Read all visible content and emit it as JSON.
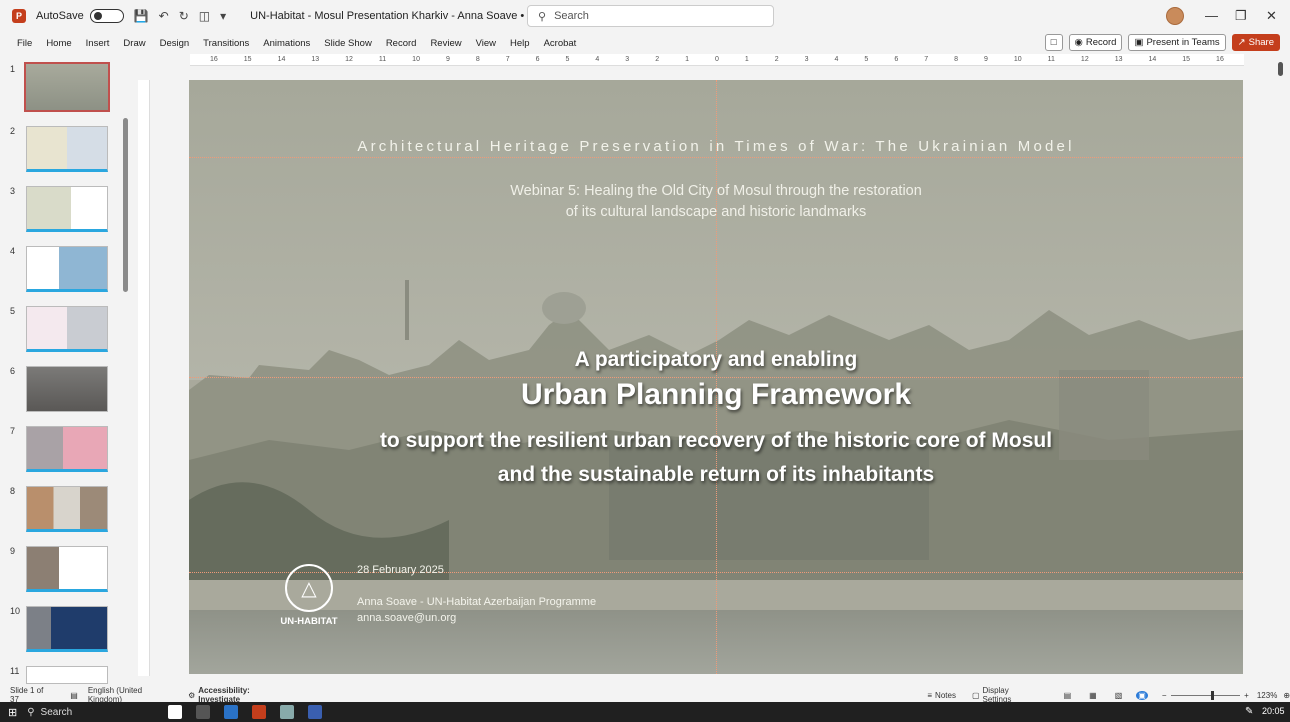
{
  "titlebar": {
    "autosave_label": "AutoSave",
    "doc_title": "UN-Habitat - Mosul Presentation Kharkiv - Anna Soave • Saved to this PC",
    "search_placeholder": "Search"
  },
  "menu": {
    "tabs": [
      "File",
      "Home",
      "Insert",
      "Draw",
      "Design",
      "Transitions",
      "Animations",
      "Slide Show",
      "Record",
      "Review",
      "View",
      "Help",
      "Acrobat"
    ],
    "record_label": "Record",
    "present_label": "Present in Teams",
    "share_label": "Share"
  },
  "thumbnails": [
    "1",
    "2",
    "3",
    "4",
    "5",
    "6",
    "7",
    "8",
    "9",
    "10",
    "11"
  ],
  "ruler_ticks": [
    "16",
    "15",
    "14",
    "13",
    "12",
    "11",
    "10",
    "9",
    "8",
    "7",
    "6",
    "5",
    "4",
    "3",
    "2",
    "1",
    "0",
    "1",
    "2",
    "3",
    "4",
    "5",
    "6",
    "7",
    "8",
    "9",
    "10",
    "11",
    "12",
    "13",
    "14",
    "15",
    "16"
  ],
  "slide": {
    "heading": "Architectural Heritage Preservation in Times of War: The Ukrainian Model",
    "webinar_line1": "Webinar 5: Healing the Old City of Mosul through the restoration",
    "webinar_line2": "of its cultural landscape and historic landmarks",
    "main_line1": "A participatory and enabling",
    "main_line2": "Urban Planning Framework",
    "main_line3": "to support the resilient urban recovery of the historic core of Mosul",
    "main_line4": "and the sustainable return of its inhabitants",
    "date": "28 February 2025",
    "author": "Anna Soave - UN-Habitat Azerbaijan Programme",
    "email": "anna.soave@un.org",
    "logo_text": "UN-HABITAT"
  },
  "status": {
    "slide_count": "Slide 1 of 37",
    "language": "English (United Kingdom)",
    "accessibility": "Accessibility: Investigate",
    "notes": "Notes",
    "display_settings": "Display Settings",
    "zoom": "123%"
  },
  "taskbar": {
    "search": "Search",
    "time": "20:05"
  }
}
